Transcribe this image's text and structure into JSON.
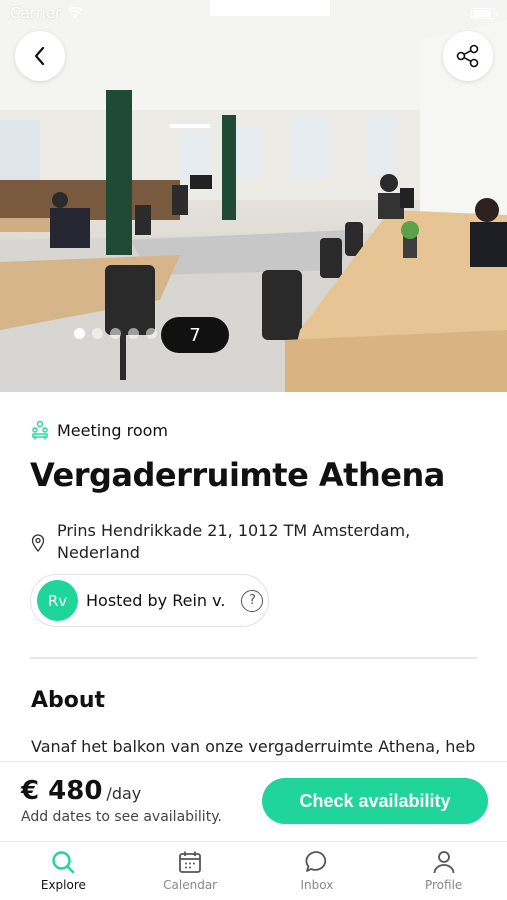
{
  "status_bar": {
    "carrier": "Carrier"
  },
  "colors": {
    "accent": "#1fd59a",
    "text": "#111111"
  },
  "hero": {
    "back_icon": "chevron-left-icon",
    "share_icon": "share-icon",
    "dots_total": 5,
    "active_dot": 0,
    "photo_count": "7"
  },
  "listing": {
    "category": "Meeting room",
    "category_icon": "meeting-room-icon",
    "title": "Vergaderruimte Athena",
    "address_line1": "Prins Hendrikkade 21, 1012 TM Amsterdam,",
    "address_line2": "Nederland",
    "host_initials": "Rv",
    "host_label": "Hosted by Rein v.",
    "help_icon": "question-icon"
  },
  "about": {
    "heading": "About",
    "text": "Vanaf het balkon van onze vergaderruimte Athena, heb"
  },
  "booking": {
    "price": "€ 480",
    "unit": "/day",
    "hint": "Add dates to see availability.",
    "cta": "Check availability"
  },
  "tabs": [
    {
      "label": "Explore",
      "icon": "search-icon",
      "active": true
    },
    {
      "label": "Calendar",
      "icon": "calendar-icon",
      "active": false
    },
    {
      "label": "Inbox",
      "icon": "chat-icon",
      "active": false
    },
    {
      "label": "Profile",
      "icon": "user-icon",
      "active": false
    }
  ]
}
